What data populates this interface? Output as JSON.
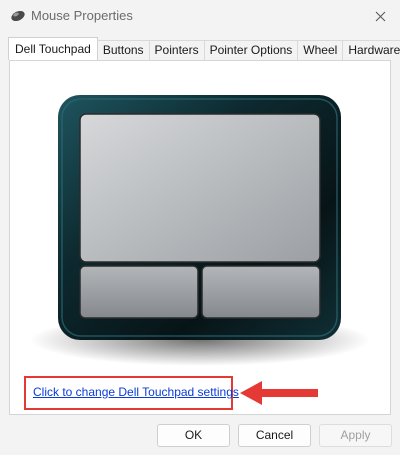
{
  "window": {
    "title": "Mouse Properties",
    "title_icon": "mouse-icon",
    "close_icon": "close-icon"
  },
  "tabs": [
    {
      "label": "Dell Touchpad",
      "active": true
    },
    {
      "label": "Buttons",
      "active": false
    },
    {
      "label": "Pointers",
      "active": false
    },
    {
      "label": "Pointer Options",
      "active": false
    },
    {
      "label": "Wheel",
      "active": false
    },
    {
      "label": "Hardware",
      "active": false
    }
  ],
  "panel": {
    "illustration_icon": "touchpad-icon",
    "settings_link": "Click to change Dell Touchpad settings",
    "annotation_icon": "arrow-left-icon"
  },
  "colors": {
    "accent_link": "#0b3bd6",
    "highlight_red": "#e53935",
    "touchpad_frame": "#0f2f35"
  },
  "footer": {
    "ok_label": "OK",
    "cancel_label": "Cancel",
    "apply_label": "Apply",
    "apply_enabled": false
  }
}
